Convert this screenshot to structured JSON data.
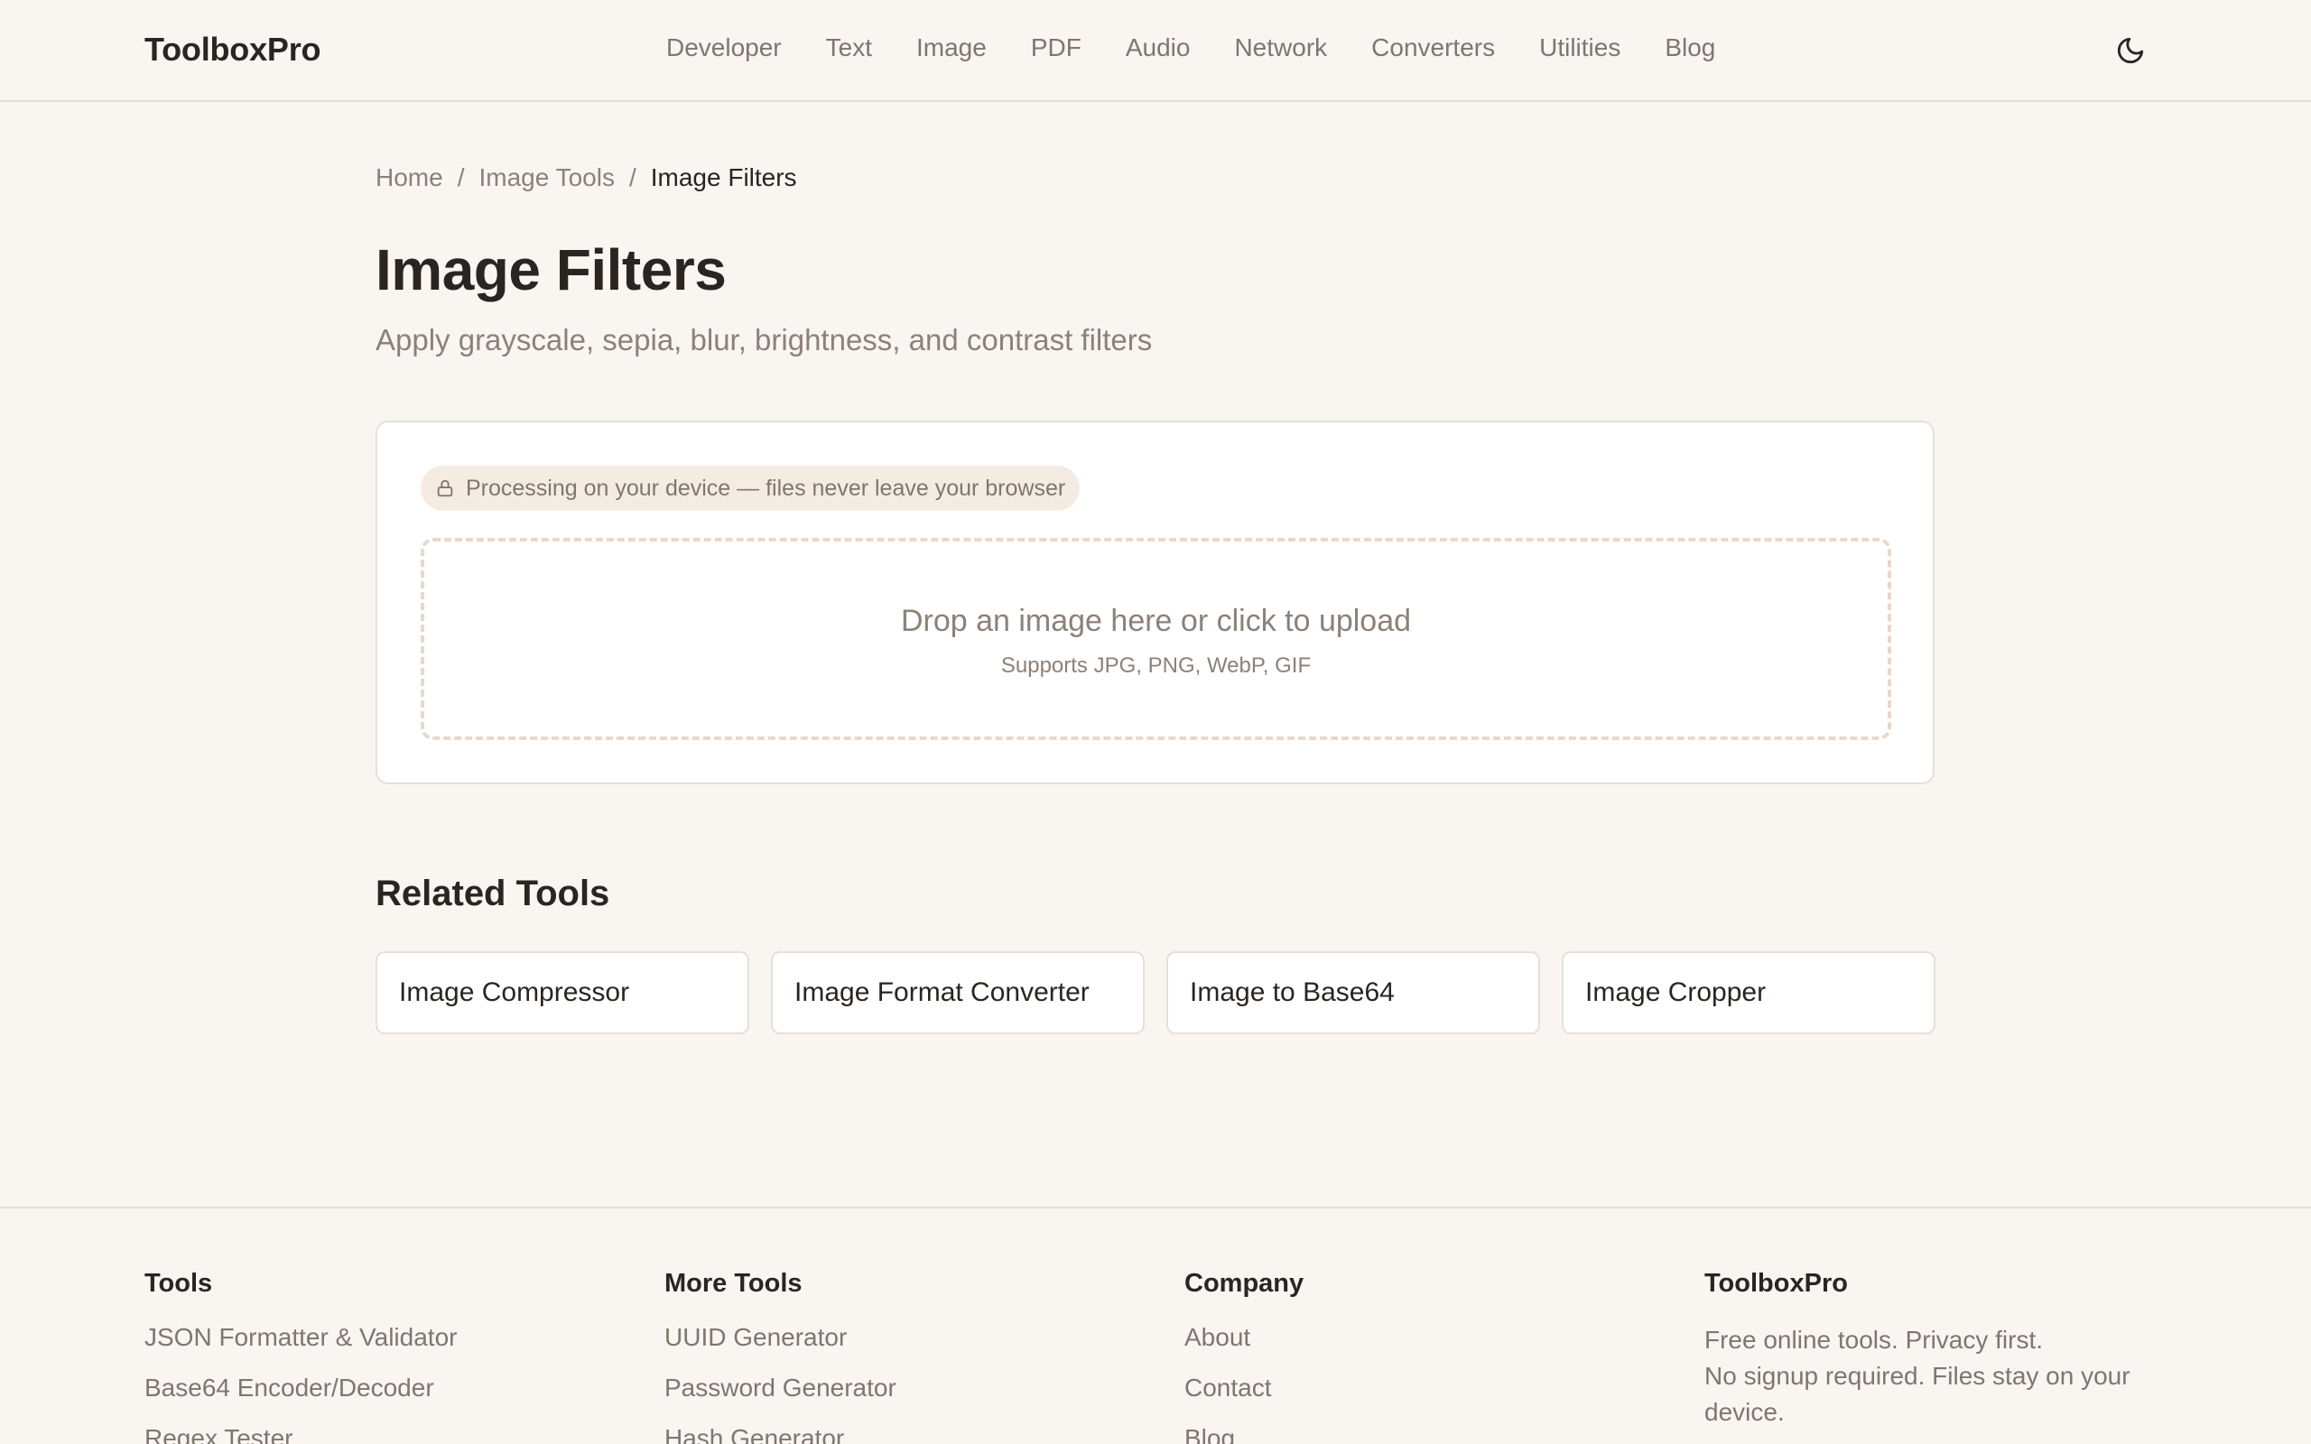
{
  "header": {
    "brand": "ToolboxPro",
    "nav": [
      "Developer",
      "Text",
      "Image",
      "PDF",
      "Audio",
      "Network",
      "Converters",
      "Utilities",
      "Blog"
    ],
    "theme_icon": "moon-icon"
  },
  "breadcrumb": {
    "home": "Home",
    "sep1": "/",
    "section": "Image Tools",
    "sep2": "/",
    "current": "Image Filters"
  },
  "page": {
    "title": "Image Filters",
    "subtitle": "Apply grayscale, sepia, blur, brightness, and contrast filters"
  },
  "tool": {
    "privacy_icon": "lock-icon",
    "privacy_text": "Processing on your device — files never leave your browser",
    "drop_title": "Drop an image here or click to upload",
    "drop_sub": "Supports JPG, PNG, WebP, GIF"
  },
  "related": {
    "title": "Related Tools",
    "items": [
      "Image Compressor",
      "Image Format Converter",
      "Image to Base64",
      "Image Cropper"
    ]
  },
  "footer": {
    "tools": {
      "title": "Tools",
      "links": [
        "JSON Formatter & Validator",
        "Base64 Encoder/Decoder",
        "Regex Tester"
      ]
    },
    "more_tools": {
      "title": "More Tools",
      "links": [
        "UUID Generator",
        "Password Generator",
        "Hash Generator"
      ]
    },
    "company": {
      "title": "Company",
      "links": [
        "About",
        "Contact",
        "Blog"
      ]
    },
    "about": {
      "title": "ToolboxPro",
      "line1": "Free online tools. Privacy first.",
      "line2": "No signup required. Files stay on your device."
    }
  },
  "colors": {
    "background": "#f9f5f1",
    "text": "#2b2520",
    "muted": "#8c8178",
    "border": "#e6e0da",
    "badge_bg": "#f4ebe3",
    "dropzone_border": "#e8d8cb"
  }
}
